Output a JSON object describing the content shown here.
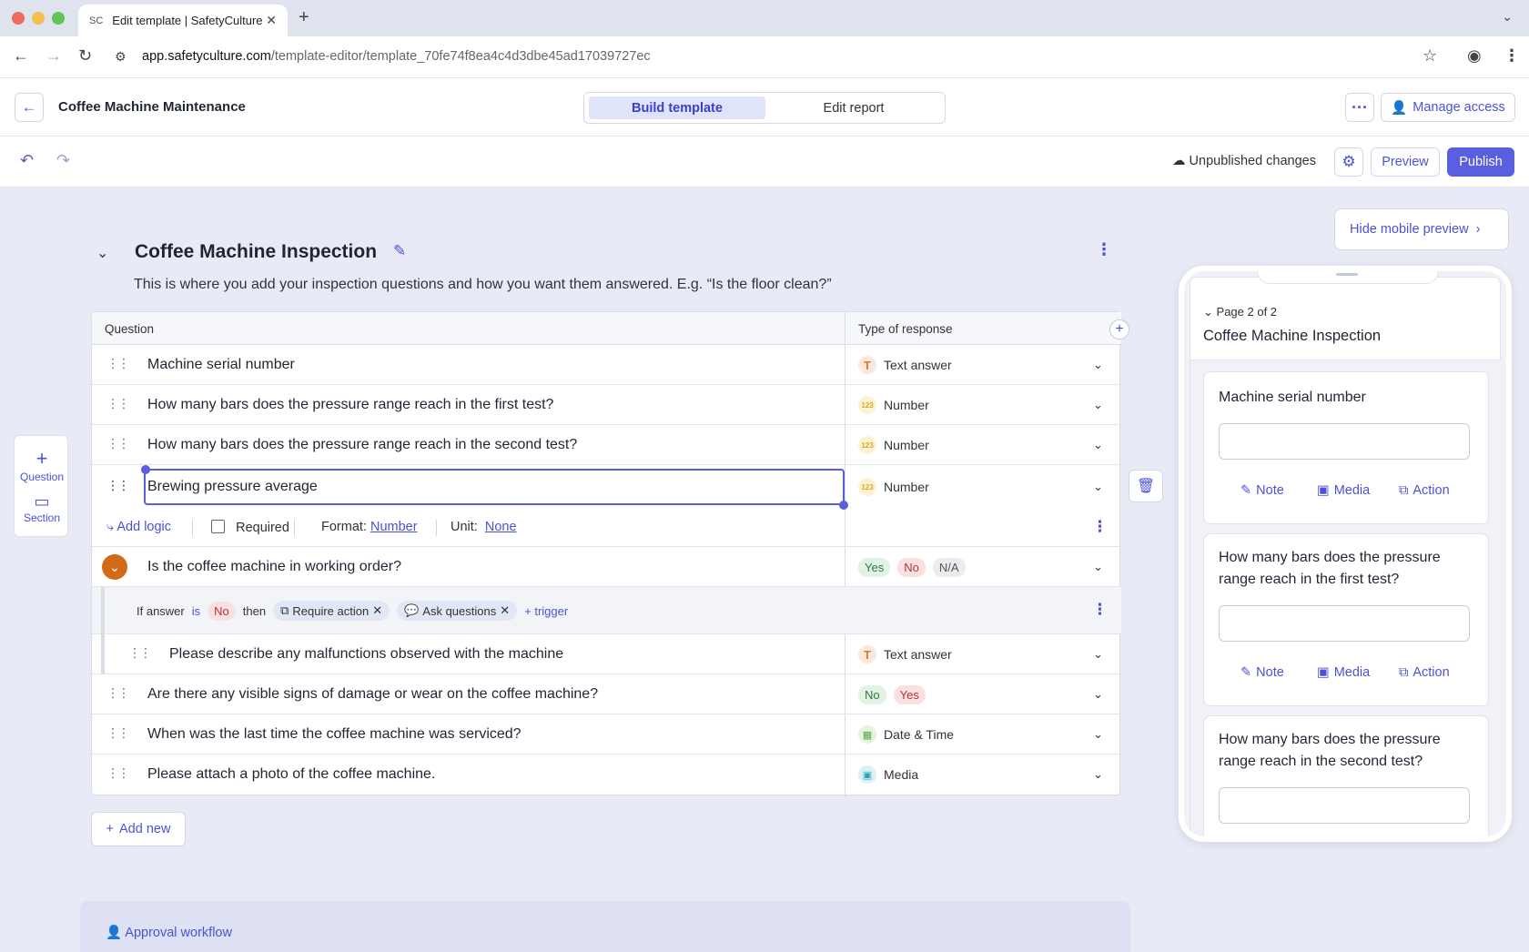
{
  "browser": {
    "tab_title": "Edit template | SafetyCulture",
    "url_host": "app.safetyculture.com",
    "url_path": "/template-editor/template_70fe74f8ea4c4d3dbe45ad17039727ec"
  },
  "header": {
    "title": "Coffee Machine Maintenance",
    "tab_build": "Build template",
    "tab_edit": "Edit report",
    "manage_access": "Manage access"
  },
  "toolbar": {
    "status": "Unpublished changes",
    "preview": "Preview",
    "publish": "Publish"
  },
  "section": {
    "title": "Coffee Machine Inspection",
    "description": "This is where you add your inspection questions and how you want them answered. E.g. “Is the floor clean?”"
  },
  "table": {
    "col_question": "Question",
    "col_type": "Type of response"
  },
  "questions": [
    {
      "text": "Machine serial number",
      "type": "Text answer"
    },
    {
      "text": "How many bars does the pressure range reach in the first test?",
      "type": "Number"
    },
    {
      "text": "How many bars does the pressure range reach in the second test?",
      "type": "Number"
    },
    {
      "text": "Brewing pressure average",
      "type": "Number"
    },
    {
      "text": "Is the coffee machine in working order?",
      "responses": [
        "Yes",
        "No",
        "N/A"
      ]
    },
    {
      "text": "Please describe any malfunctions observed with the machine",
      "type": "Text answer"
    },
    {
      "text": "Are there any visible signs of damage or wear on the coffee machine?",
      "responses": [
        "No",
        "Yes"
      ]
    },
    {
      "text": "When was the last time the coffee machine was serviced?",
      "type": "Date & Time"
    },
    {
      "text": "Please attach a photo of the coffee machine.",
      "type": "Media"
    }
  ],
  "options": {
    "add_logic": "Add logic",
    "required": "Required",
    "format_label": "Format:",
    "format_value": "Number",
    "unit_label": "Unit:",
    "unit_value": "None"
  },
  "logic": {
    "if_answer": "If answer",
    "is": "is",
    "answer": "No",
    "then": "then",
    "trigger1": "Require action",
    "trigger2": "Ask questions",
    "add_trigger": "+ trigger"
  },
  "addbar": {
    "question": "Question",
    "section": "Section"
  },
  "add_new": "Add new",
  "approval": "Approval workflow",
  "mobile": {
    "hide": "Hide mobile preview",
    "page": "Page 2 of 2",
    "title": "Coffee Machine Inspection",
    "q1": "Machine serial number",
    "q2": "How many bars does the pressure range reach in the first test?",
    "q3": "How many bars does the pressure range reach in the second test?",
    "note": "Note",
    "media": "Media",
    "action": "Action"
  }
}
